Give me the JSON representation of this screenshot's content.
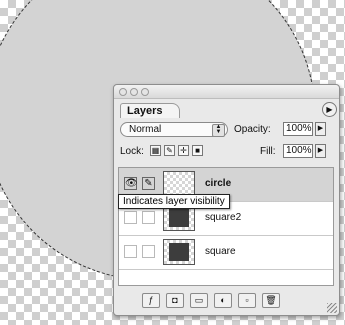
{
  "canvas": {
    "selection_shape": "ellipse",
    "fill_color": "#d3d3d3"
  },
  "panel": {
    "tab_label": "Layers",
    "blend_mode": "Normal",
    "opacity_label": "Opacity:",
    "opacity_value": "100%",
    "lock_label": "Lock:",
    "fill_label": "Fill:",
    "fill_value": "100%",
    "icons": [
      "eye-icon",
      "brush-icon",
      "lock-transparency-icon",
      "lock-image-icon",
      "lock-position-icon",
      "lock-all-icon",
      "panel-menu-icon"
    ],
    "layers": [
      {
        "name": "circle",
        "visible": true,
        "selected": true,
        "thumb": "transparent"
      },
      {
        "name": "square2",
        "visible": false,
        "selected": false,
        "thumb": "dark-square"
      },
      {
        "name": "square",
        "visible": false,
        "selected": false,
        "thumb": "dark-square"
      }
    ],
    "tooltip": "Indicates layer visibility",
    "bottom_buttons": [
      "layer-style-icon",
      "add-mask-icon",
      "new-set-icon",
      "adjustment-layer-icon",
      "new-layer-icon",
      "trash-icon"
    ]
  }
}
